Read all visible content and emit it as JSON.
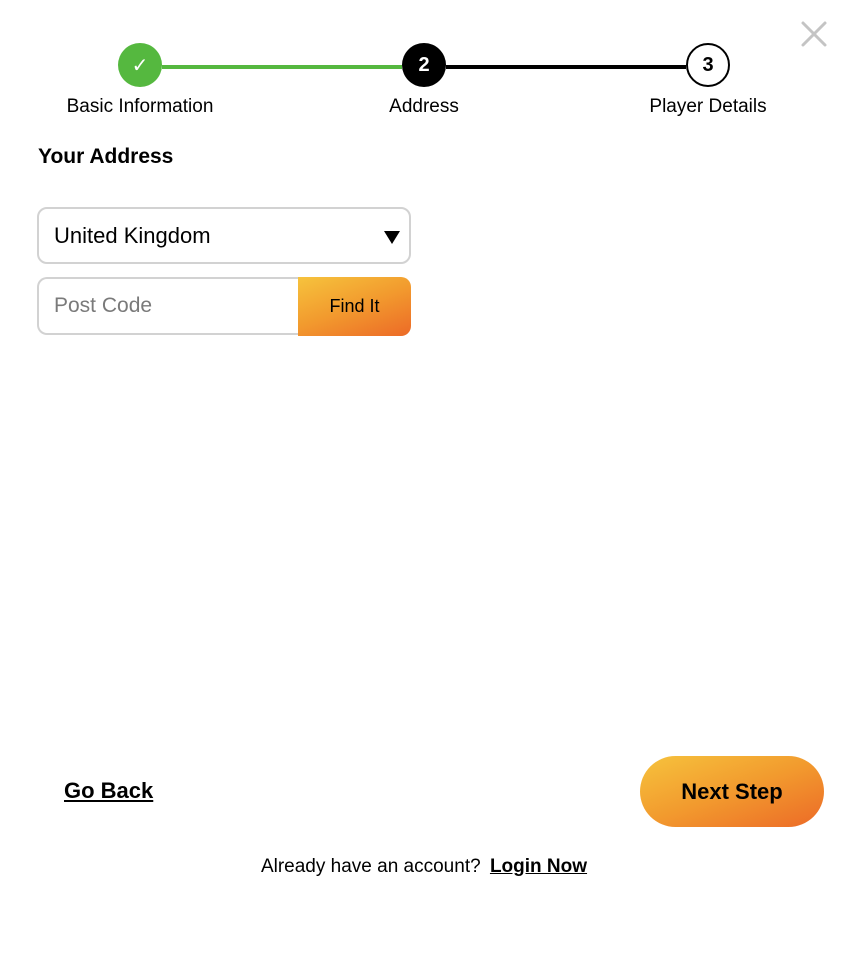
{
  "close_icon": "close-icon",
  "stepper": {
    "steps": [
      {
        "marker": "✓",
        "label": "Basic Information",
        "state": "complete"
      },
      {
        "marker": "2",
        "label": "Address",
        "state": "current"
      },
      {
        "marker": "3",
        "label": "Player Details",
        "state": "upcoming"
      }
    ],
    "colors": {
      "complete": "#55b83f",
      "current": "#000000"
    }
  },
  "form": {
    "title": "Your Address",
    "country": {
      "value": "United Kingdom",
      "icon": "triangle-down-icon"
    },
    "postcode": {
      "placeholder": "Post Code",
      "value": ""
    },
    "find_label": "Find It"
  },
  "footer": {
    "back_label": "Go Back",
    "next_label": "Next Step",
    "login_prompt": "Already have an account?",
    "login_link": "Login Now"
  },
  "colors": {
    "accent_start": "#f6c33d",
    "accent_end": "#ec6a27"
  }
}
